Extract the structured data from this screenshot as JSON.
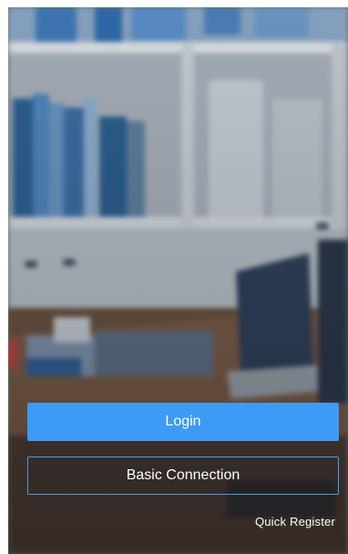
{
  "actions": {
    "login_label": "Login",
    "basic_connection_label": "Basic Connection",
    "quick_register_label": "Quick Register"
  },
  "colors": {
    "primary": "#3d9bf5",
    "outline": "#4a9ce8",
    "text": "#ffffff"
  }
}
